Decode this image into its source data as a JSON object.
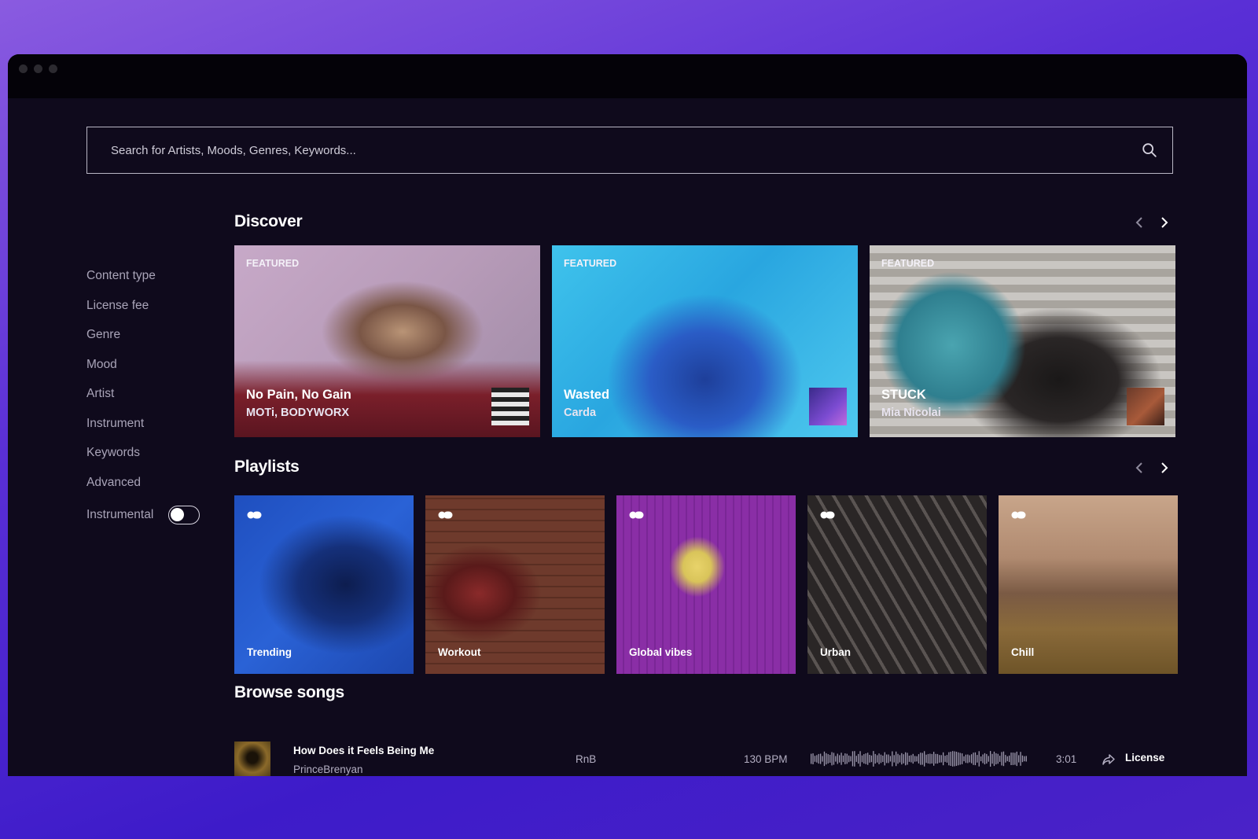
{
  "search": {
    "placeholder": "Search for Artists, Moods, Genres, Keywords..."
  },
  "sidebar": {
    "filters": [
      "Content type",
      "License fee",
      "Genre",
      "Mood",
      "Artist",
      "Instrument",
      "Keywords",
      "Advanced"
    ],
    "instrumental_label": "Instrumental",
    "instrumental_on": false
  },
  "discover": {
    "title": "Discover",
    "cards": [
      {
        "badge": "FEATURED",
        "title": "No Pain, No Gain",
        "artist": "MOTi, BODYWORX"
      },
      {
        "badge": "FEATURED",
        "title": "Wasted",
        "artist": "Carda"
      },
      {
        "badge": "FEATURED",
        "title": "STUCK",
        "artist": "Mia Nicolai"
      }
    ]
  },
  "playlists": {
    "title": "Playlists",
    "items": [
      "Trending",
      "Workout",
      "Global vibes",
      "Urban",
      "Chill"
    ]
  },
  "browse": {
    "title": "Browse songs",
    "song": {
      "title": "How Does it Feels Being Me",
      "artist": "PrinceBrenyan",
      "genre": "RnB",
      "bpm": "130 BPM",
      "duration": "3:01",
      "action": "License"
    }
  },
  "colors": {
    "window_bg": "#0f0a1c",
    "titlebar_bg": "#040208",
    "accent_gradient_start": "#8a5be0",
    "accent_gradient_end": "#3d1bc9"
  }
}
